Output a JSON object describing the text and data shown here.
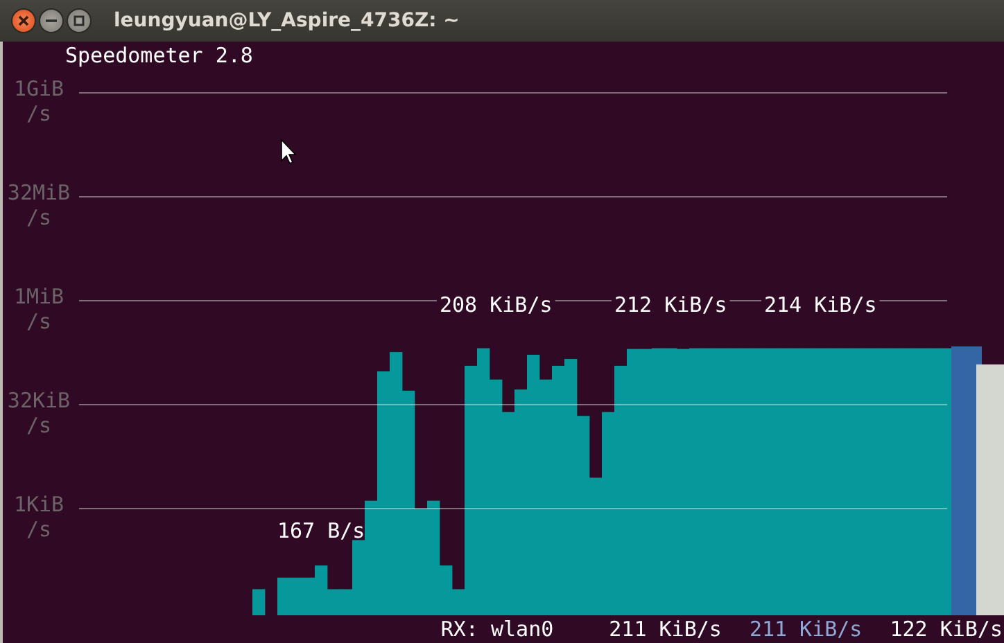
{
  "window": {
    "title": "leungyuan@LY_Aspire_4736Z: ~"
  },
  "terminal": {
    "header": "Speedometer 2.8",
    "graph": {
      "axis_labels": [
        "1GiB /s",
        "32MiB /s",
        "1MiB /s",
        "32KiB /s",
        "1KiB /s"
      ],
      "peak_labels": [
        "167 B/s",
        "208 KiB/s",
        "212 KiB/s",
        "214 KiB/s"
      ]
    },
    "status": [
      {
        "text": "RX: wlan0",
        "color": "#ffffff"
      },
      {
        "text": "211 KiB/s",
        "color": "#ffffff"
      },
      {
        "text": "211 KiB/s",
        "color": "#8fa8d8"
      },
      {
        "text": "122 KiB/s",
        "color": "#ffffff"
      }
    ]
  }
}
